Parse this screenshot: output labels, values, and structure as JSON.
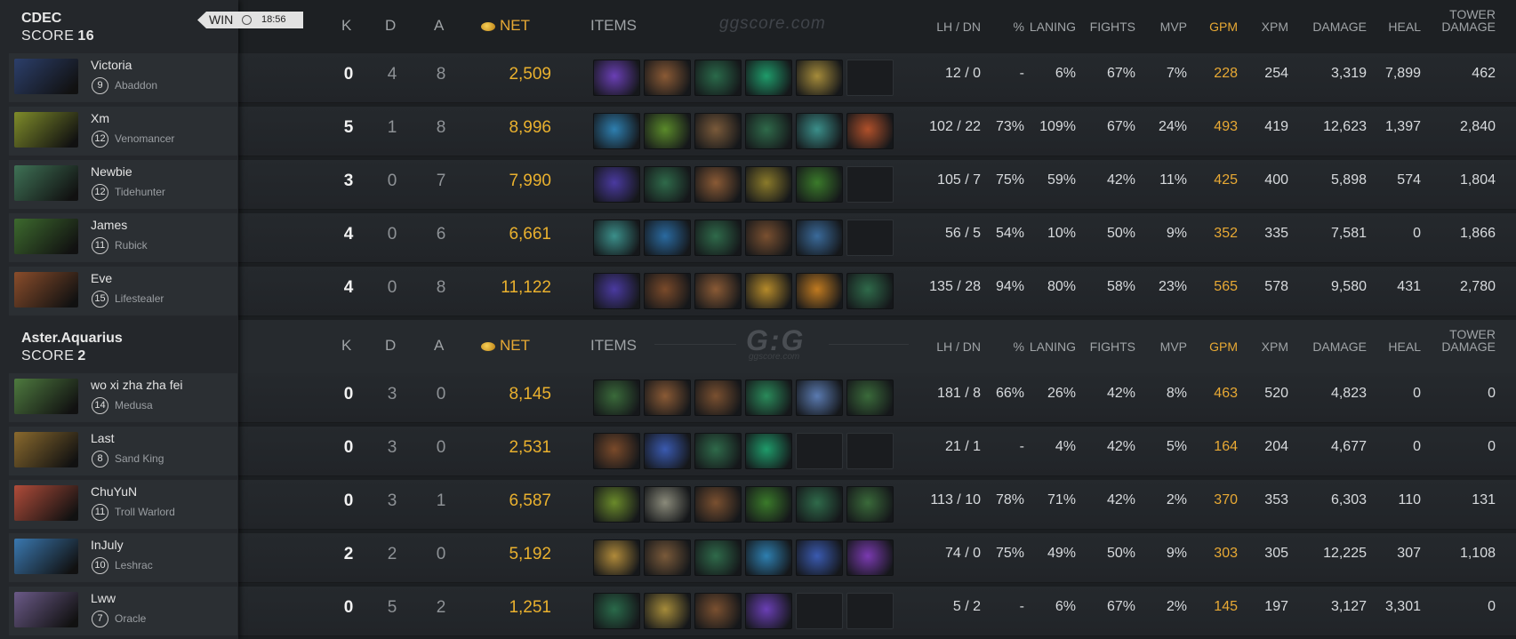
{
  "teams": [
    {
      "name": "CDEC",
      "score_label": "SCORE",
      "score": "16",
      "result": "WIN",
      "duration": "18:56",
      "players": [
        {
          "name": "Victoria",
          "level": "9",
          "hero": "Abaddon",
          "k": "0",
          "d": "4",
          "a": "8",
          "net": "2,509",
          "items": [
            "arcane-boots",
            "quelling-blade",
            "blight-stone",
            "tranquil-boots",
            "midas",
            "empty"
          ],
          "lh": "12",
          "dn": "0",
          "pct": "-",
          "laning": "6%",
          "fights": "67%",
          "mvp": "7%",
          "gpm": "228",
          "xpm": "254",
          "damage": "3,319",
          "heal": "7,899",
          "tower": "462",
          "portrait": "#2c3f6b"
        },
        {
          "name": "Xm",
          "level": "12",
          "hero": "Venomancer",
          "k": "5",
          "d": "1",
          "a": "8",
          "net": "8,996",
          "items": [
            "aether-lens",
            "veil",
            "urn",
            "wand",
            "eul",
            "urn2"
          ],
          "lh": "102",
          "dn": "22",
          "pct": "73%",
          "laning": "109%",
          "fights": "67%",
          "mvp": "24%",
          "gpm": "493",
          "xpm": "419",
          "damage": "12,623",
          "heal": "1,397",
          "tower": "2,840",
          "portrait": "#7f8c2a"
        },
        {
          "name": "Newbie",
          "level": "12",
          "hero": "Tidehunter",
          "k": "3",
          "d": "0",
          "a": "7",
          "net": "7,990",
          "items": [
            "blink",
            "wand",
            "quelling-blade",
            "drum",
            "hood",
            "empty"
          ],
          "lh": "105",
          "dn": "7",
          "pct": "75%",
          "laning": "59%",
          "fights": "42%",
          "mvp": "11%",
          "gpm": "425",
          "xpm": "400",
          "damage": "5,898",
          "heal": "574",
          "tower": "1,804",
          "portrait": "#3f7256"
        },
        {
          "name": "James",
          "level": "11",
          "hero": "Rubick",
          "k": "4",
          "d": "0",
          "a": "6",
          "net": "6,661",
          "items": [
            "eul",
            "wind",
            "wand",
            "boots",
            "glimmer",
            "empty"
          ],
          "lh": "56",
          "dn": "5",
          "pct": "54%",
          "laning": "10%",
          "fights": "50%",
          "mvp": "9%",
          "gpm": "352",
          "xpm": "335",
          "damage": "7,581",
          "heal": "0",
          "tower": "1,866",
          "portrait": "#3d6a2e"
        },
        {
          "name": "Eve",
          "level": "15",
          "hero": "Lifestealer",
          "k": "4",
          "d": "0",
          "a": "8",
          "net": "11,122",
          "items": [
            "blink",
            "vanguard",
            "quelling-blade",
            "armlet",
            "radiance",
            "wand"
          ],
          "lh": "135",
          "dn": "28",
          "pct": "94%",
          "laning": "80%",
          "fights": "58%",
          "mvp": "23%",
          "gpm": "565",
          "xpm": "578",
          "damage": "9,580",
          "heal": "431",
          "tower": "2,780",
          "portrait": "#8a4d2b"
        }
      ]
    },
    {
      "name": "Aster.Aquarius",
      "score_label": "SCORE",
      "score": "2",
      "players": [
        {
          "name": "wo xi zha zha fei",
          "level": "14",
          "hero": "Medusa",
          "k": "0",
          "d": "3",
          "a": "0",
          "net": "8,145",
          "items": [
            "ring",
            "quelling-blade",
            "boots",
            "yasha",
            "diffusal",
            "ring2"
          ],
          "lh": "181",
          "dn": "8",
          "pct": "66%",
          "laning": "26%",
          "fights": "42%",
          "mvp": "8%",
          "gpm": "463",
          "xpm": "520",
          "damage": "4,823",
          "heal": "0",
          "tower": "0",
          "portrait": "#4e7a3f"
        },
        {
          "name": "Last",
          "level": "8",
          "hero": "Sand King",
          "k": "0",
          "d": "3",
          "a": "0",
          "net": "2,531",
          "items": [
            "vanguard",
            "potion",
            "wand",
            "tranquil-boots",
            "empty",
            "empty"
          ],
          "lh": "21",
          "dn": "1",
          "pct": "-",
          "laning": "4%",
          "fights": "42%",
          "mvp": "5%",
          "gpm": "164",
          "xpm": "204",
          "damage": "4,677",
          "heal": "0",
          "tower": "0",
          "portrait": "#8a6a2e"
        },
        {
          "name": "ChuYuN",
          "level": "11",
          "hero": "Troll Warlord",
          "k": "0",
          "d": "3",
          "a": "1",
          "net": "6,587",
          "items": [
            "mango",
            "mushroom",
            "boots",
            "hood",
            "wand",
            "ring"
          ],
          "lh": "113",
          "dn": "10",
          "pct": "78%",
          "laning": "71%",
          "fights": "42%",
          "mvp": "2%",
          "gpm": "370",
          "xpm": "353",
          "damage": "6,303",
          "heal": "110",
          "tower": "131",
          "portrait": "#b04c3a"
        },
        {
          "name": "InJuly",
          "level": "10",
          "hero": "Leshrac",
          "k": "2",
          "d": "2",
          "a": "0",
          "net": "5,192",
          "items": [
            "crown",
            "urn",
            "wand",
            "aether-lens",
            "potion",
            "dagon"
          ],
          "lh": "74",
          "dn": "0",
          "pct": "75%",
          "laning": "49%",
          "fights": "50%",
          "mvp": "9%",
          "gpm": "303",
          "xpm": "305",
          "damage": "12,225",
          "heal": "307",
          "tower": "1,108",
          "portrait": "#3a78b0"
        },
        {
          "name": "Lww",
          "level": "7",
          "hero": "Oracle",
          "k": "0",
          "d": "5",
          "a": "2",
          "net": "1,251",
          "items": [
            "blight-stone",
            "midas",
            "boots",
            "arcane-boots",
            "empty",
            "empty"
          ],
          "lh": "5",
          "dn": "2",
          "pct": "-",
          "laning": "6%",
          "fights": "67%",
          "mvp": "2%",
          "gpm": "145",
          "xpm": "197",
          "damage": "3,127",
          "heal": "3,301",
          "tower": "0",
          "portrait": "#6b5a88"
        }
      ]
    }
  ],
  "headers": {
    "k": "K",
    "d": "D",
    "a": "A",
    "net": "NET",
    "items": "ITEMS",
    "lhdn": "LH / DN",
    "pct": "%",
    "laning": "LANING",
    "fights": "FIGHTS",
    "mvp": "MVP",
    "gpm": "GPM",
    "xpm": "XPM",
    "damage": "DAMAGE",
    "heal": "HEAL",
    "tower1": "TOWER",
    "tower2": "DAMAGE"
  },
  "watermarks": {
    "top": "ggscore.com",
    "mid_logo": "G:G",
    "mid_sub": "ggscore.com"
  },
  "item_colors": {
    "arcane-boots": "#6a3fb5",
    "quelling-blade": "#8a5a35",
    "blight-stone": "#2a6a4a",
    "tranquil-boots": "#1f9b6a",
    "midas": "#a58b3a",
    "aether-lens": "#2e7fb0",
    "veil": "#5a8a2a",
    "urn": "#7a5a3a",
    "wand": "#2f6a4a",
    "eul": "#3b8f8a",
    "urn2": "#b0502a",
    "blink": "#4a3aa0",
    "drum": "#8a7a2a",
    "hood": "#3a7a2a",
    "wind": "#2a6aa0",
    "boots": "#7a5030",
    "glimmer": "#3a6a9a",
    "vanguard": "#7a4a2a",
    "armlet": "#b58a2a",
    "radiance": "#c07a20",
    "ring": "#3a6a3a",
    "yasha": "#2a8a5a",
    "diffusal": "#5a7ab0",
    "ring2": "#3a6a3a",
    "potion": "#3a5ab0",
    "mango": "#6a8a2a",
    "mushroom": "#8a8a7a",
    "crown": "#b08a3a",
    "dagon": "#7a3ab0"
  }
}
